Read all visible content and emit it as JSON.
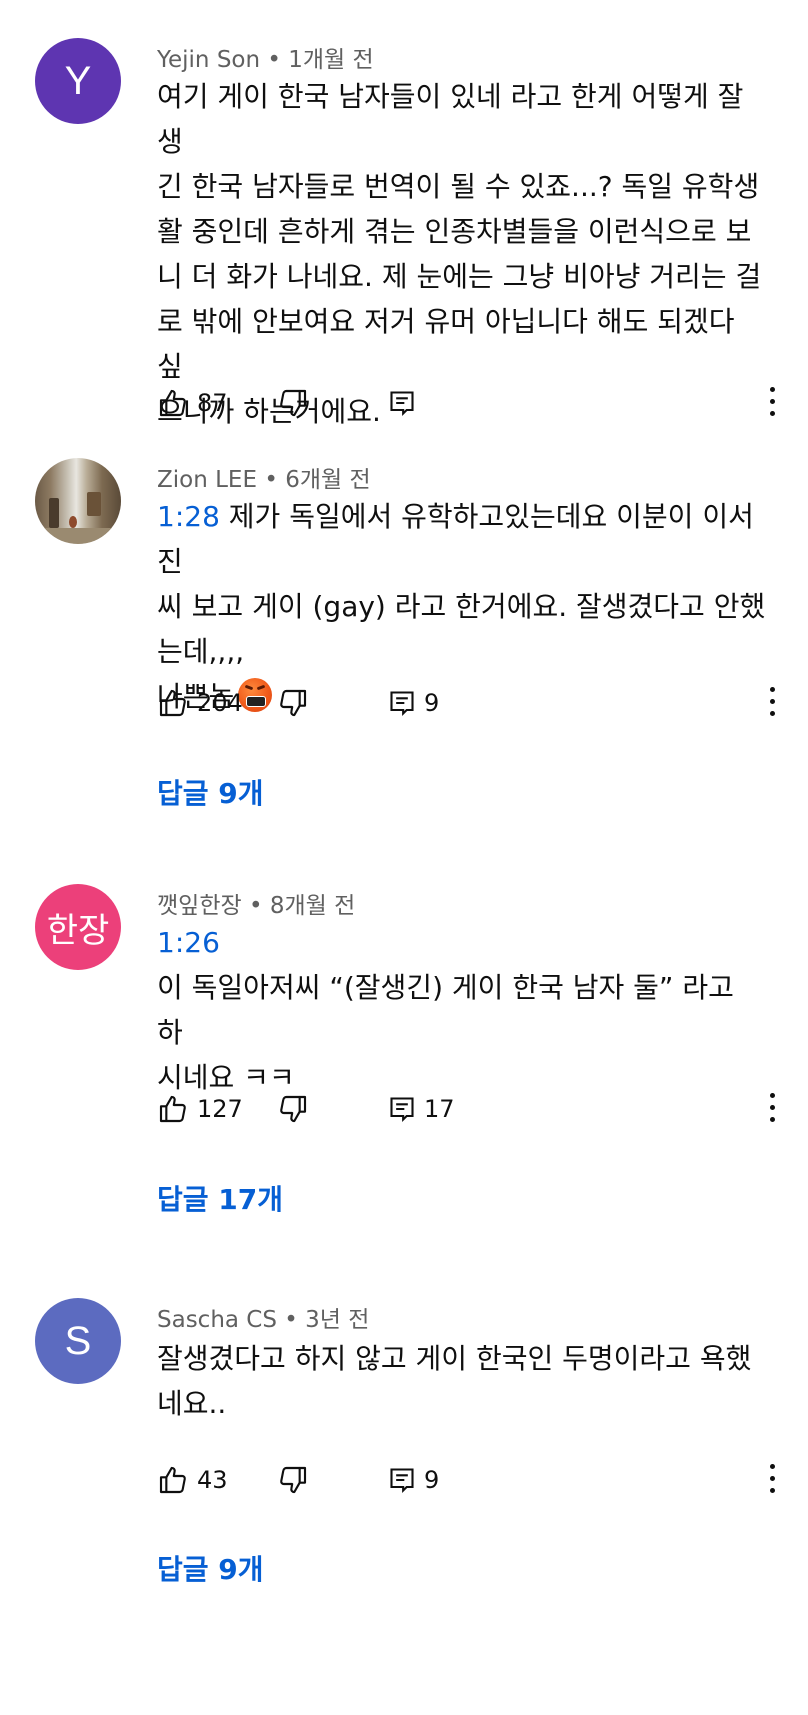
{
  "comments": [
    {
      "author": "Yejin Son",
      "time": "1개월 전",
      "avatar_letter": "Y",
      "avatar_color": "#5e35b1",
      "text": "여기 게이 한국 남자들이 있네 라고 한게 어떻게 잘생\n긴 한국 남자들로 번역이 될 수 있죠...? 독일 유학생\n활 중인데 흔하게 겪는 인종차별들을 이런식으로 보\n니 더 화가 나네요. 제 눈에는 그냥 비아냥 거리는 걸\n로 밖에 안보여요 저거 유머 아닙니다 해도 되겠다 싶\n으니까 하는거에요.",
      "likes": "87"
    },
    {
      "author": "Zion LEE",
      "time": "6개월 전",
      "timestamp": "1:28",
      "text_after_timestamp": " 제가 독일에서 유학하고있는데요 이분이 이서진\n씨 보고 게이 (gay) 라고 한거에요. 잘생겼다고 안했\n는데,,,,",
      "text_line_last": "나쁜놈",
      "likes": "204",
      "reply_count": "9",
      "replies_label": "답글 9개"
    },
    {
      "author": "깻잎한장",
      "time": "8개월 전",
      "avatar_text": "한장",
      "avatar_color": "#ec407a",
      "timestamp": "1:26",
      "text": "이 독일아저씨 “(잘생긴) 게이 한국 남자 둘” 라고 하\n시네요 ㅋㅋ",
      "likes": "127",
      "reply_count": "17",
      "replies_label": "답글 17개"
    },
    {
      "author": "Sascha CS",
      "time": "3년 전",
      "avatar_letter": "S",
      "avatar_color": "#5c6bc0",
      "text": "잘생겼다고 하지 않고 게이 한국인 두명이라고 욕했\n네요..",
      "likes": "43",
      "reply_count": "9",
      "replies_label": "답글 9개"
    }
  ],
  "meta_separator": "•",
  "icons": [
    "like-icon",
    "dislike-icon",
    "reply-icon",
    "more-options-icon",
    "angry-face-emoji"
  ],
  "colors": {
    "link_blue": "#065fd4",
    "meta_gray": "#606060",
    "text": "#0f0f0f"
  }
}
